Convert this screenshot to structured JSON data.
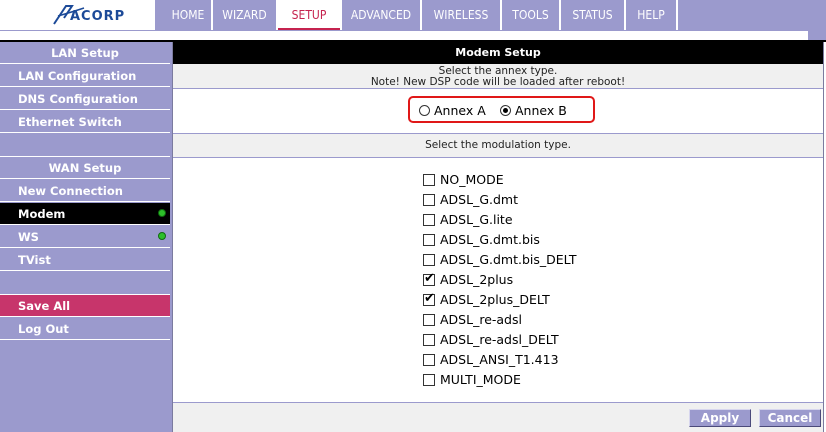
{
  "brand": {
    "logo_text": "ACORP",
    "logo_color": "#1c4a98"
  },
  "nav": {
    "items": [
      {
        "label": "HOME"
      },
      {
        "label": "WIZARD"
      },
      {
        "label": "SETUP"
      },
      {
        "label": "ADVANCED"
      },
      {
        "label": "WIRELESS"
      },
      {
        "label": "TOOLS"
      },
      {
        "label": "STATUS"
      },
      {
        "label": "HELP"
      }
    ],
    "active": "SETUP",
    "bar_color": "#9b9acd",
    "active_color": "#c5234f"
  },
  "sidebar": {
    "lan_header": "LAN Setup",
    "lan_items": [
      {
        "label": "LAN Configuration"
      },
      {
        "label": "DNS Configuration"
      },
      {
        "label": "Ethernet Switch"
      }
    ],
    "wan_header": "WAN Setup",
    "wan_items": [
      {
        "label": "New Connection"
      },
      {
        "label": "Modem",
        "active": true,
        "status": "green-dot"
      },
      {
        "label": "WS",
        "status": "green-dot"
      },
      {
        "label": "TVist"
      }
    ],
    "save_all": "Save All",
    "log_out": "Log Out",
    "save_color": "#c7356b"
  },
  "main": {
    "title": "Modem Setup",
    "annex_prompt": "Select the annex type.",
    "annex_note": "Note! New DSP code will be loaded after reboot!",
    "annex_options": [
      {
        "label": "Annex A",
        "selected": false
      },
      {
        "label": "Annex B",
        "selected": true
      }
    ],
    "highlight_color": "#e01818",
    "modulation_prompt": "Select the modulation type.",
    "modulation_options": [
      {
        "label": "NO_MODE",
        "checked": false
      },
      {
        "label": "ADSL_G.dmt",
        "checked": false
      },
      {
        "label": "ADSL_G.lite",
        "checked": false
      },
      {
        "label": "ADSL_G.dmt.bis",
        "checked": false
      },
      {
        "label": "ADSL_G.dmt.bis_DELT",
        "checked": false
      },
      {
        "label": "ADSL_2plus",
        "checked": true
      },
      {
        "label": "ADSL_2plus_DELT",
        "checked": true
      },
      {
        "label": "ADSL_re-adsl",
        "checked": false
      },
      {
        "label": "ADSL_re-adsl_DELT",
        "checked": false
      },
      {
        "label": "ADSL_ANSI_T1.413",
        "checked": false
      },
      {
        "label": "MULTI_MODE",
        "checked": false
      }
    ],
    "apply_label": "Apply",
    "cancel_label": "Cancel"
  }
}
